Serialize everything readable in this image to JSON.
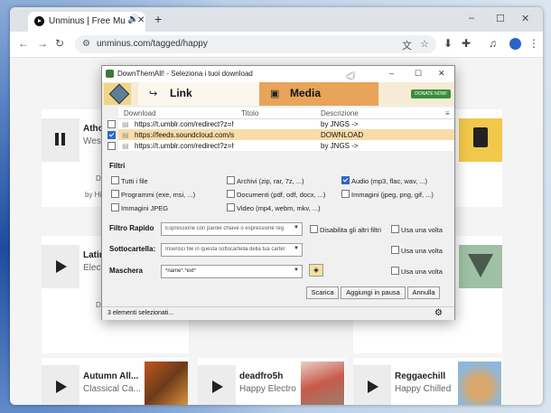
{
  "browser": {
    "tab_title": "Unminus | Free Music. No F",
    "url": "unminus.com/tagged/happy",
    "new_tab": "+",
    "win_min": "–",
    "win_max": "☐",
    "win_close": "✕"
  },
  "page": {
    "cards": [
      {
        "title": "Athon",
        "subtitle": "West",
        "meta": "DO",
        "by": "by Hil",
        "state": "pause"
      },
      {
        "title": "Latin",
        "subtitle": "Electr",
        "meta": "DO",
        "state": "play"
      },
      {
        "title": "Autumn All...",
        "subtitle": "Classical Ca...",
        "state": "play"
      },
      {
        "title": "deadfro5h",
        "subtitle": "Happy Electro",
        "state": "play"
      },
      {
        "title": "Reggaechill",
        "subtitle": "Happy Chilled",
        "state": "play"
      }
    ]
  },
  "dialog": {
    "title": "DownThemAll! - Seleziona i tuoi download",
    "tab_link": "Link",
    "tab_media": "Media",
    "donate": "DONATE NOW!",
    "columns": {
      "download": "Download",
      "titolo": "Titolo",
      "descrizione": "Descrizione"
    },
    "rows": [
      {
        "url": "https://t.umblr.com/redirect?z=ht...",
        "title": "",
        "desc": "by JNGS ->",
        "checked": false,
        "selected": false
      },
      {
        "url": "https://feeds.soundcloud.com/str...",
        "title": "",
        "desc": "DOWNLOAD",
        "checked": true,
        "selected": true
      },
      {
        "url": "https://t.umblr.com/redirect?z=ht...",
        "title": "",
        "desc": "by JNGS ->",
        "checked": false,
        "selected": false
      }
    ],
    "filtri_label": "Filtri",
    "filters": [
      {
        "label": "Tutti i file",
        "checked": false
      },
      {
        "label": "Archivi (zip, rar, 7z, ...)",
        "checked": false
      },
      {
        "label": "Audio (mp3, flac, wav, ...)",
        "checked": true
      },
      {
        "label": "Programmi (exe, msi, ...)",
        "checked": false
      },
      {
        "label": "Documenti (pdf, odf, docx, ...)",
        "checked": false
      },
      {
        "label": "Immagini (jpeg, png, gif, ...)",
        "checked": false
      },
      {
        "label": "Immagini JPEG",
        "checked": false
      },
      {
        "label": "Video (mp4, webm, mkv, ...)",
        "checked": false
      }
    ],
    "filtro_rapido": {
      "label": "Filtro Rapido",
      "placeholder": "Espressione con parole chiave o espressione reg",
      "disable": "Disabilita gli altri filtri",
      "once": "Usa una volta"
    },
    "sottocartella": {
      "label": "Sottocartella:",
      "placeholder": "Inserisci file in questa sottocartella della tua cartel",
      "once": "Usa una volta"
    },
    "maschera": {
      "label": "Maschera",
      "value": "*name*.*ext*",
      "once": "Usa una volta"
    },
    "buttons": {
      "scarica": "Scarica",
      "aggiungi": "Aggiungi in pausa",
      "annulla": "Annulla"
    },
    "status": "3 elementi selezionati..."
  }
}
